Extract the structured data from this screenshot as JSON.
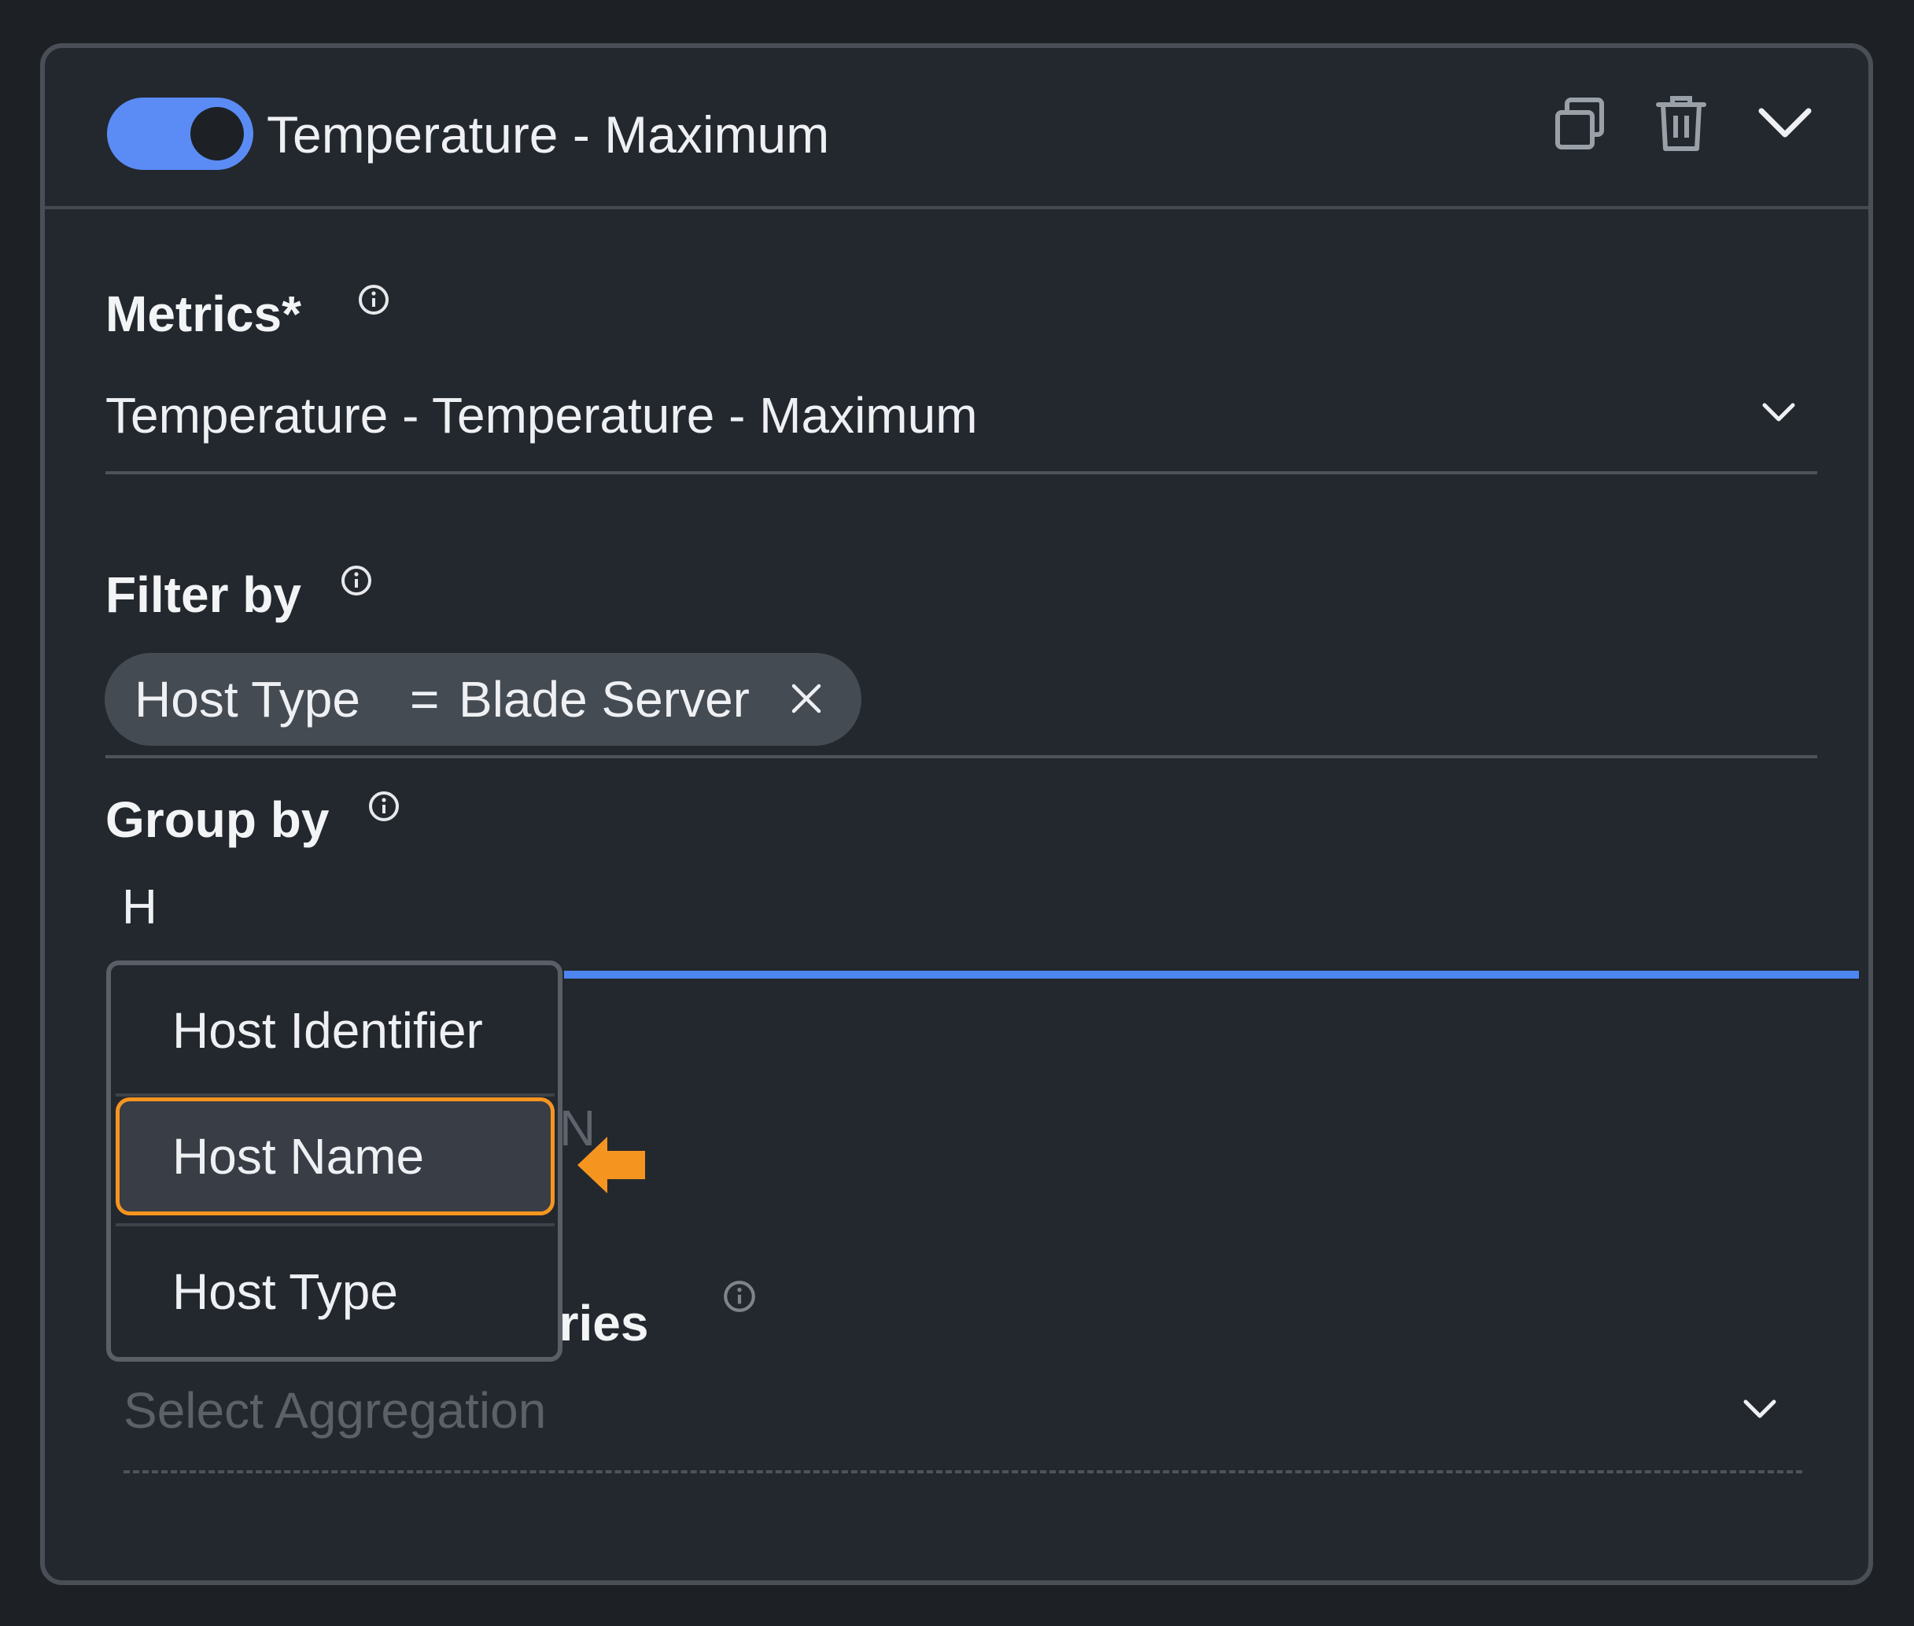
{
  "header": {
    "toggle_state": "on",
    "title": "Temperature - Maximum",
    "icons": [
      "copy-icon",
      "trash-icon",
      "chevron-down-icon"
    ]
  },
  "metrics": {
    "label": "Metrics*",
    "selected": "Temperature - Temperature - Maximum"
  },
  "filter_by": {
    "label": "Filter by",
    "chip": {
      "key": "Host Type",
      "operator": "=",
      "value": "Blade Server"
    }
  },
  "group_by": {
    "label": "Group by",
    "input_value": "H",
    "partial_hidden_text": "N"
  },
  "dropdown": {
    "items": [
      "Host Identifier",
      "Host Name",
      "Host Type"
    ],
    "highlighted": "Host Name"
  },
  "aggregate": {
    "label_partial": "eries",
    "placeholder": "Select Aggregation"
  },
  "colors": {
    "background": "#23282e",
    "toggle": "#5b8cf5",
    "accent_line": "#4d86f0",
    "highlight": "#f59520"
  }
}
